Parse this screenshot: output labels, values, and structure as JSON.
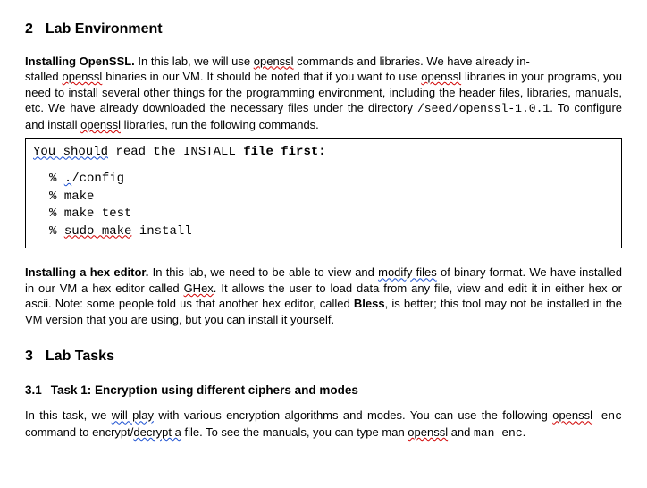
{
  "sec2": {
    "num": "2",
    "title": "Lab Environment",
    "p1": {
      "lead": "Installing OpenSSL.",
      "t1": " In this lab, we will use ",
      "w1": "openssl",
      "t2": " commands and libraries. We have already in-",
      "t3": "stalled ",
      "w2": "openssl",
      "t4": " binaries in our VM. It should be noted that if you want to use ",
      "w3": "openssl",
      "t5": " libraries in your programs, you need to install several other things for the programming environment, including the header files, libraries, manuals, etc. We have already downloaded the necessary files under the directory ",
      "path": "/seed/openssl-1.0.1",
      "t6": ". To configure and install ",
      "w4": "openssl",
      "t7": " libraries, run the following commands."
    },
    "codebox": {
      "intro_you_should": "You should",
      "intro_rest": " read the INSTALL ",
      "intro_file": "file first:",
      "c1_pct": "% ",
      "c1_dot": ".",
      "c1_rest": "/config",
      "c2": "% make",
      "c3": "% make test",
      "c4_pct": "% ",
      "c4_sudo": "sudo  make",
      "c4_rest": " install"
    },
    "p2": {
      "lead": "Installing a hex editor.",
      "t1": "  In this lab, we need to be able to view and ",
      "w1": "modify  files",
      "t2": " of binary format. We have installed in our VM a hex editor called ",
      "w2": "GHex",
      "t3": ". It allows the user to load data from any file, view and edit it in either hex or ascii. Note: some people told us that another hex editor, called ",
      "bless": "Bless",
      "t4": ", is better; this tool may not be installed in the VM version that you are using, but you can install it yourself."
    }
  },
  "sec3": {
    "num": "3",
    "title": "Lab Tasks",
    "sub": {
      "num": "3.1",
      "title": "Task 1: Encryption  using different  ciphers and modes"
    },
    "p": {
      "t1": "In this task, we ",
      "w1": "will  play",
      "t2": " with various encryption algorithms and modes. You can use the following ",
      "w2": "openssl",
      "enc": " enc",
      "t3": " command to encrypt/",
      "w3": "decrypt  a",
      "t4": " file.  To see the manuals, you can type man ",
      "w4": "openssl",
      "t5": " and ",
      "manenc": "man enc",
      "t6": "."
    }
  }
}
